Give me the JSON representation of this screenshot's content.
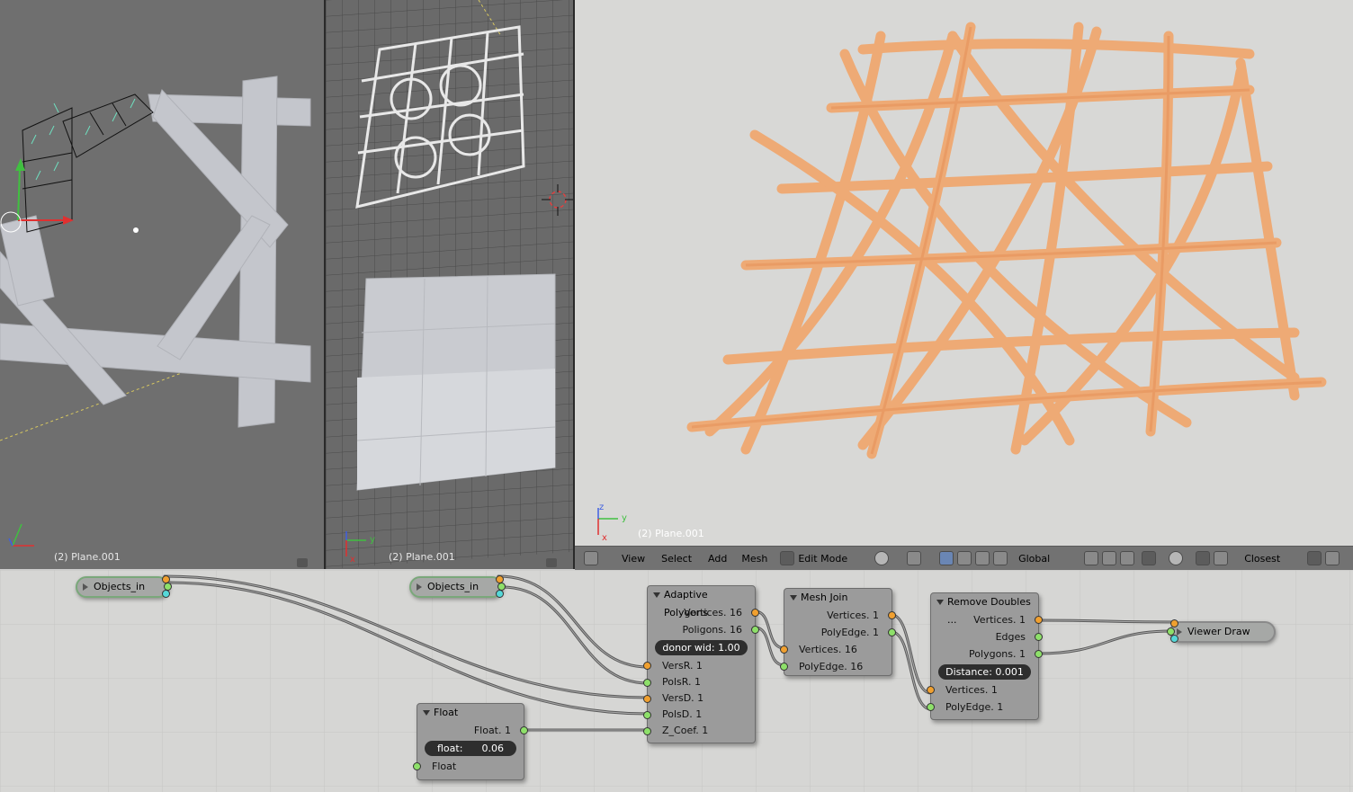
{
  "viewports": {
    "left": {
      "object_label": "(2) Plane.001"
    },
    "middle": {
      "object_label": "(2) Plane.001"
    },
    "right": {
      "object_label": "(2) Plane.001"
    }
  },
  "axes": {
    "x": "x",
    "y": "y",
    "z": "z"
  },
  "header": {
    "view": "View",
    "select": "Select",
    "add": "Add",
    "mesh": "Mesh",
    "mode": "Edit Mode",
    "orientation": "Global",
    "snap": "Closest"
  },
  "nodes": {
    "objects_in_1": {
      "label": "Objects_in"
    },
    "objects_in_2": {
      "label": "Objects_in"
    },
    "float": {
      "title": "Float",
      "out": "Float. 1",
      "field": "float:",
      "value": "0.06",
      "in": "Float"
    },
    "adaptive": {
      "title": "Adaptive Polygons",
      "out_vertices": "Vertices. 16",
      "out_polygons": "Poligons. 16",
      "field": "donor wid: 1.00",
      "in_versr": "VersR. 1",
      "in_polsr": "PolsR. 1",
      "in_versd": "VersD. 1",
      "in_polsd": "PolsD. 1",
      "in_zcoef": "Z_Coef. 1"
    },
    "meshjoin": {
      "title": "Mesh Join",
      "out_vertices": "Vertices. 1",
      "out_polyedge": "PolyEdge. 1",
      "in_vertices": "Vertices. 16",
      "in_polyedge": "PolyEdge. 16"
    },
    "removedoubles": {
      "title": "Remove Doubles ...",
      "out_vertices": "Vertices. 1",
      "out_edges": "Edges",
      "out_polygons": "Polygons. 1",
      "field": "Distance: 0.001",
      "in_vertices": "Vertices. 1",
      "in_polyedge": "PolyEdge. 1"
    },
    "viewer": {
      "label": "Viewer Draw"
    }
  }
}
